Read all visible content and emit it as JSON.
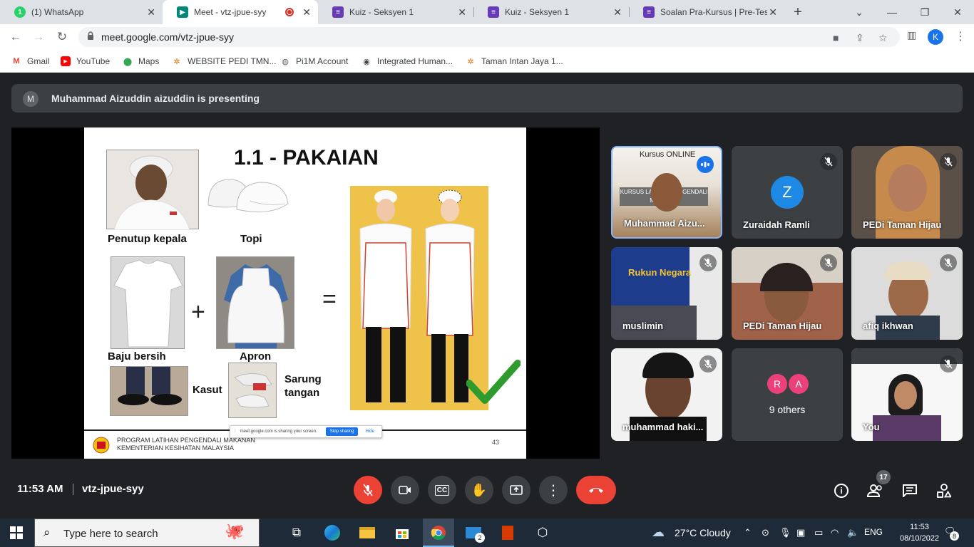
{
  "browser": {
    "tabs": [
      {
        "title": "(1) WhatsApp",
        "icon": "whatsapp-icon",
        "color": "#25d366"
      },
      {
        "title": "Meet - vtz-jpue-syy",
        "icon": "google-meet-icon",
        "color": "#00897b",
        "active": true
      },
      {
        "title": "Kuiz - Seksyen 1",
        "icon": "google-forms-icon",
        "color": "#673ab7"
      },
      {
        "title": "Kuiz - Seksyen 1",
        "icon": "google-forms-icon",
        "color": "#673ab7"
      },
      {
        "title": "Soalan Pra-Kursus | Pre-Test",
        "icon": "google-forms-icon",
        "color": "#673ab7"
      }
    ],
    "url": "meet.google.com/vtz-jpue-syy",
    "profile_initial": "K",
    "bookmarks": [
      {
        "label": "Gmail",
        "icon": "gmail-icon"
      },
      {
        "label": "YouTube",
        "icon": "youtube-icon"
      },
      {
        "label": "Maps",
        "icon": "maps-icon"
      },
      {
        "label": "WEBSITE PEDI TMN...",
        "icon": "pedi-icon"
      },
      {
        "label": "Pi1M Account",
        "icon": "pi1m-icon"
      },
      {
        "label": "Integrated Human...",
        "icon": "globe-icon"
      },
      {
        "label": "Taman Intan Jaya 1...",
        "icon": "pedi-icon"
      }
    ]
  },
  "meet": {
    "presenting_initial": "M",
    "presenting_text": "Muhammad Aizuddin aizuddin is presenting",
    "slide": {
      "title": "1.1 - PAKAIAN",
      "labels": {
        "penutup": "Penutup kepala",
        "topi": "Topi",
        "baju": "Baju bersih",
        "apron": "Apron",
        "kasut": "Kasut",
        "sarung": "Sarung tangan",
        "plus": "+",
        "equals": "="
      },
      "footer_line1": "PROGRAM LATIHAN PENGENDALI MAKANAN",
      "footer_line2": "KEMENTERIAN KESIHATAN MALAYSIA",
      "page_number": "43",
      "share_text": "meet.google.com is sharing your screen.",
      "stop_sharing": "Stop sharing",
      "hide": "Hide"
    },
    "participants": [
      {
        "name": "Muhammad Aizu...",
        "overlay": "Kursus ONLINE",
        "overlay2": "KURSUS LATIHAN PENGENDALI MAKANAN",
        "speaking": true
      },
      {
        "name": "Zuraidah Ramli",
        "initial": "Z"
      },
      {
        "name": "PEDi Taman Hijau"
      },
      {
        "name": "muslimin",
        "overlay": "Rukun Negara"
      },
      {
        "name": "PEDi Taman Hijau"
      },
      {
        "name": "afiq ikhwan"
      },
      {
        "name": "muhammad haki..."
      },
      {
        "name": "9 others",
        "initials": [
          "R",
          "A"
        ]
      },
      {
        "name": "You"
      }
    ],
    "clock": "11:53 AM",
    "meeting_code": "vtz-jpue-syy",
    "people_count": "17"
  },
  "taskbar": {
    "search_placeholder": "Type here to search",
    "weather": "27°C  Cloudy",
    "language": "ENG",
    "time": "11:53",
    "date": "08/10/2022",
    "notifications": "8",
    "mail_badge": "2"
  }
}
